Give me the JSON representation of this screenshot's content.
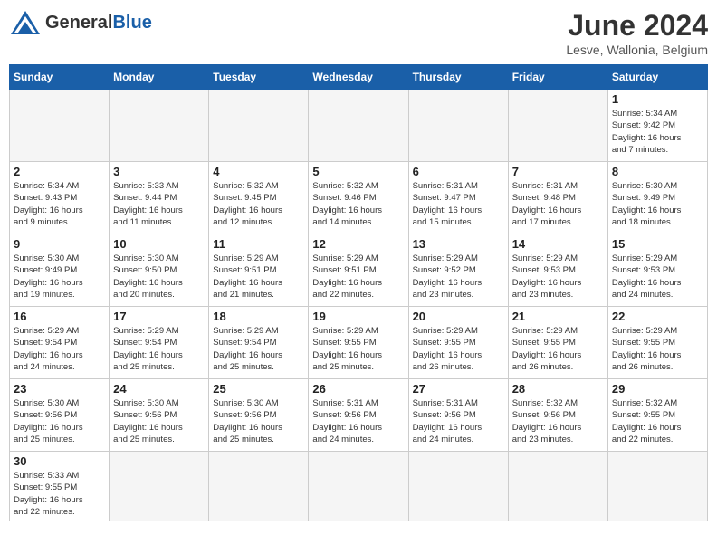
{
  "header": {
    "logo_general": "General",
    "logo_blue": "Blue",
    "title": "June 2024",
    "subtitle": "Lesve, Wallonia, Belgium"
  },
  "days_of_week": [
    "Sunday",
    "Monday",
    "Tuesday",
    "Wednesday",
    "Thursday",
    "Friday",
    "Saturday"
  ],
  "weeks": [
    [
      {
        "day": "",
        "info": ""
      },
      {
        "day": "",
        "info": ""
      },
      {
        "day": "",
        "info": ""
      },
      {
        "day": "",
        "info": ""
      },
      {
        "day": "",
        "info": ""
      },
      {
        "day": "",
        "info": ""
      },
      {
        "day": "1",
        "info": "Sunrise: 5:34 AM\nSunset: 9:42 PM\nDaylight: 16 hours\nand 7 minutes."
      }
    ],
    [
      {
        "day": "2",
        "info": "Sunrise: 5:34 AM\nSunset: 9:43 PM\nDaylight: 16 hours\nand 9 minutes."
      },
      {
        "day": "3",
        "info": "Sunrise: 5:33 AM\nSunset: 9:44 PM\nDaylight: 16 hours\nand 11 minutes."
      },
      {
        "day": "4",
        "info": "Sunrise: 5:32 AM\nSunset: 9:45 PM\nDaylight: 16 hours\nand 12 minutes."
      },
      {
        "day": "5",
        "info": "Sunrise: 5:32 AM\nSunset: 9:46 PM\nDaylight: 16 hours\nand 14 minutes."
      },
      {
        "day": "6",
        "info": "Sunrise: 5:31 AM\nSunset: 9:47 PM\nDaylight: 16 hours\nand 15 minutes."
      },
      {
        "day": "7",
        "info": "Sunrise: 5:31 AM\nSunset: 9:48 PM\nDaylight: 16 hours\nand 17 minutes."
      },
      {
        "day": "8",
        "info": "Sunrise: 5:30 AM\nSunset: 9:49 PM\nDaylight: 16 hours\nand 18 minutes."
      }
    ],
    [
      {
        "day": "9",
        "info": "Sunrise: 5:30 AM\nSunset: 9:49 PM\nDaylight: 16 hours\nand 19 minutes."
      },
      {
        "day": "10",
        "info": "Sunrise: 5:30 AM\nSunset: 9:50 PM\nDaylight: 16 hours\nand 20 minutes."
      },
      {
        "day": "11",
        "info": "Sunrise: 5:29 AM\nSunset: 9:51 PM\nDaylight: 16 hours\nand 21 minutes."
      },
      {
        "day": "12",
        "info": "Sunrise: 5:29 AM\nSunset: 9:51 PM\nDaylight: 16 hours\nand 22 minutes."
      },
      {
        "day": "13",
        "info": "Sunrise: 5:29 AM\nSunset: 9:52 PM\nDaylight: 16 hours\nand 23 minutes."
      },
      {
        "day": "14",
        "info": "Sunrise: 5:29 AM\nSunset: 9:53 PM\nDaylight: 16 hours\nand 23 minutes."
      },
      {
        "day": "15",
        "info": "Sunrise: 5:29 AM\nSunset: 9:53 PM\nDaylight: 16 hours\nand 24 minutes."
      }
    ],
    [
      {
        "day": "16",
        "info": "Sunrise: 5:29 AM\nSunset: 9:54 PM\nDaylight: 16 hours\nand 24 minutes."
      },
      {
        "day": "17",
        "info": "Sunrise: 5:29 AM\nSunset: 9:54 PM\nDaylight: 16 hours\nand 25 minutes."
      },
      {
        "day": "18",
        "info": "Sunrise: 5:29 AM\nSunset: 9:54 PM\nDaylight: 16 hours\nand 25 minutes."
      },
      {
        "day": "19",
        "info": "Sunrise: 5:29 AM\nSunset: 9:55 PM\nDaylight: 16 hours\nand 25 minutes."
      },
      {
        "day": "20",
        "info": "Sunrise: 5:29 AM\nSunset: 9:55 PM\nDaylight: 16 hours\nand 26 minutes."
      },
      {
        "day": "21",
        "info": "Sunrise: 5:29 AM\nSunset: 9:55 PM\nDaylight: 16 hours\nand 26 minutes."
      },
      {
        "day": "22",
        "info": "Sunrise: 5:29 AM\nSunset: 9:55 PM\nDaylight: 16 hours\nand 26 minutes."
      }
    ],
    [
      {
        "day": "23",
        "info": "Sunrise: 5:30 AM\nSunset: 9:56 PM\nDaylight: 16 hours\nand 25 minutes."
      },
      {
        "day": "24",
        "info": "Sunrise: 5:30 AM\nSunset: 9:56 PM\nDaylight: 16 hours\nand 25 minutes."
      },
      {
        "day": "25",
        "info": "Sunrise: 5:30 AM\nSunset: 9:56 PM\nDaylight: 16 hours\nand 25 minutes."
      },
      {
        "day": "26",
        "info": "Sunrise: 5:31 AM\nSunset: 9:56 PM\nDaylight: 16 hours\nand 24 minutes."
      },
      {
        "day": "27",
        "info": "Sunrise: 5:31 AM\nSunset: 9:56 PM\nDaylight: 16 hours\nand 24 minutes."
      },
      {
        "day": "28",
        "info": "Sunrise: 5:32 AM\nSunset: 9:56 PM\nDaylight: 16 hours\nand 23 minutes."
      },
      {
        "day": "29",
        "info": "Sunrise: 5:32 AM\nSunset: 9:55 PM\nDaylight: 16 hours\nand 22 minutes."
      }
    ],
    [
      {
        "day": "30",
        "info": "Sunrise: 5:33 AM\nSunset: 9:55 PM\nDaylight: 16 hours\nand 22 minutes."
      },
      {
        "day": "",
        "info": ""
      },
      {
        "day": "",
        "info": ""
      },
      {
        "day": "",
        "info": ""
      },
      {
        "day": "",
        "info": ""
      },
      {
        "day": "",
        "info": ""
      },
      {
        "day": "",
        "info": ""
      }
    ]
  ]
}
